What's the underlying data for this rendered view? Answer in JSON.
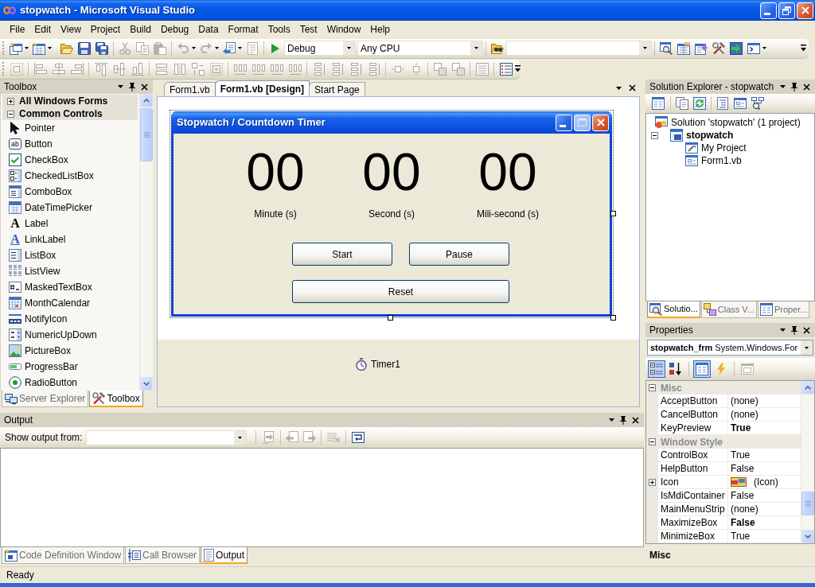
{
  "window": {
    "title": "stopwatch - Microsoft Visual Studio"
  },
  "menu": [
    {
      "label": "File"
    },
    {
      "label": "Edit"
    },
    {
      "label": "View"
    },
    {
      "label": "Project"
    },
    {
      "label": "Build"
    },
    {
      "label": "Debug"
    },
    {
      "label": "Data"
    },
    {
      "label": "Format"
    },
    {
      "label": "Tools"
    },
    {
      "label": "Test"
    },
    {
      "label": "Window"
    },
    {
      "label": "Help"
    }
  ],
  "standard_toolbar": {
    "edit_disabled": true,
    "configuration": {
      "value": "Debug"
    },
    "platform": {
      "value": "Any CPU"
    }
  },
  "layout_toolbar": {
    "disabled": true
  },
  "toolbox": {
    "title": "Toolbox",
    "categories": [
      {
        "label": "All Windows Forms",
        "expanded": false
      },
      {
        "label": "Common Controls",
        "expanded": true,
        "items": [
          {
            "label": "Pointer"
          },
          {
            "label": "Button",
            "glyph": "ab"
          },
          {
            "label": "CheckBox"
          },
          {
            "label": "CheckedListBox"
          },
          {
            "label": "ComboBox"
          },
          {
            "label": "DateTimePicker"
          },
          {
            "label": "Label",
            "glyph": "A"
          },
          {
            "label": "LinkLabel",
            "glyph": "A"
          },
          {
            "label": "ListBox"
          },
          {
            "label": "ListView"
          },
          {
            "label": "MaskedTextBox"
          },
          {
            "label": "MonthCalendar"
          },
          {
            "label": "NotifyIcon"
          },
          {
            "label": "NumericUpDown"
          },
          {
            "label": "PictureBox"
          },
          {
            "label": "ProgressBar"
          },
          {
            "label": "RadioButton"
          }
        ]
      }
    ],
    "tabs": [
      {
        "label": "Server Explorer",
        "selected": false
      },
      {
        "label": "Toolbox",
        "selected": true
      }
    ]
  },
  "editor": {
    "tabs": [
      {
        "label": "Form1.vb",
        "selected": false
      },
      {
        "label": "Form1.vb [Design]",
        "selected": true
      },
      {
        "label": "Start Page",
        "selected": false
      }
    ],
    "form": {
      "title": "Stopwatch / Countdown Timer",
      "selected": true,
      "maximize_enabled": false,
      "displays": [
        {
          "value": "00",
          "label": "Minute (s)"
        },
        {
          "value": "00",
          "label": "Second (s)"
        },
        {
          "value": "00",
          "label": "Mili-second (s)"
        }
      ],
      "button_rows": [
        [
          "Start",
          "Pause"
        ],
        [
          "Reset"
        ]
      ]
    },
    "tray": [
      {
        "label": "Timer1"
      }
    ]
  },
  "output": {
    "title": "Output",
    "source": {
      "label": "Show output from:"
    },
    "navigation_disabled": true,
    "tabs": [
      {
        "label": "Code Definition Window",
        "selected": false
      },
      {
        "label": "Call Browser",
        "selected": false
      },
      {
        "label": "Output",
        "selected": true
      }
    ]
  },
  "solution_explorer": {
    "title": "Solution Explorer - stopwatch",
    "tree": [
      {
        "label": "Solution 'stopwatch' (1 project)",
        "children": [
          {
            "label": "stopwatch",
            "startup": true,
            "expanded": true,
            "children": [
              {
                "label": "My Project"
              },
              {
                "label": "Form1.vb"
              }
            ]
          }
        ]
      }
    ],
    "tabs": [
      {
        "label": "Solutio...",
        "selected": true
      },
      {
        "label": "Class V...",
        "selected": false
      },
      {
        "label": "Proper...",
        "selected": false
      }
    ]
  },
  "properties": {
    "title": "Properties",
    "object": {
      "name": "stopwatch_frm",
      "type": "System.Windows.For"
    },
    "sort_buttons": [
      {
        "selected": true
      },
      {
        "selected": false
      }
    ],
    "view_buttons": [
      {
        "selected": true
      },
      {
        "selected": false
      }
    ],
    "property_pages_disabled": true,
    "categories": [
      {
        "label": "Misc",
        "expanded": true,
        "rows": [
          {
            "name": "AcceptButton",
            "value": "(none)",
            "modified": false,
            "kind": "text"
          },
          {
            "name": "CancelButton",
            "value": "(none)",
            "modified": false,
            "kind": "text"
          },
          {
            "name": "KeyPreview",
            "value": "True",
            "modified": true,
            "kind": "text"
          }
        ]
      },
      {
        "label": "Window Style",
        "expanded": true,
        "rows": [
          {
            "name": "ControlBox",
            "value": "True",
            "modified": false,
            "kind": "text"
          },
          {
            "name": "HelpButton",
            "value": "False",
            "modified": false,
            "kind": "text"
          },
          {
            "name": "Icon",
            "value": "(Icon)",
            "modified": false,
            "kind": "image",
            "expanded": false
          },
          {
            "name": "IsMdiContainer",
            "value": "False",
            "modified": false,
            "kind": "text"
          },
          {
            "name": "MainMenuStrip",
            "value": "(none)",
            "modified": false,
            "kind": "text"
          },
          {
            "name": "MaximizeBox",
            "value": "False",
            "modified": true,
            "kind": "text"
          },
          {
            "name": "MinimizeBox",
            "value": "True",
            "modified": false,
            "kind": "text"
          }
        ]
      }
    ],
    "description": {
      "title": "Misc"
    }
  },
  "status_bar": {
    "text": "Ready"
  }
}
